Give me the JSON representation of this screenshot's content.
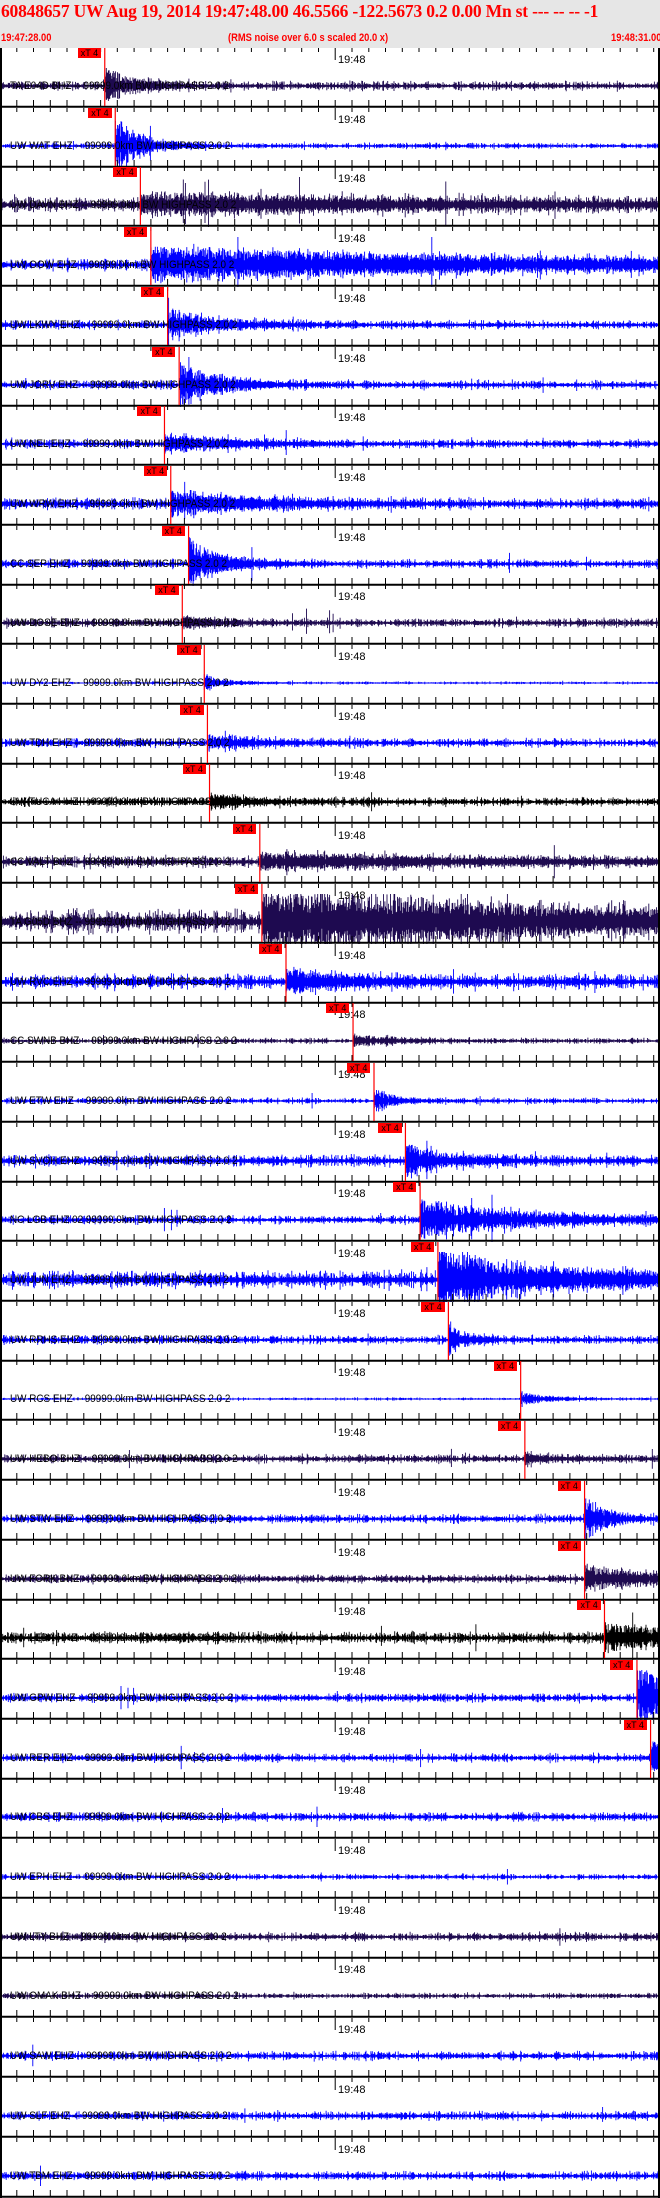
{
  "header": {
    "title": "60848657 UW Aug 19, 2014 19:47:48.00   46.5566 -122.5673  0.2 0.00 Mn st --- -- --  -1",
    "start_time": "19:47:28.00",
    "scaling_note": "(RMS noise over 6.0 s scaled 20.0 x)",
    "end_time": "19:48:31.00"
  },
  "axis": {
    "window_seconds": 63,
    "minute_mark_label": "19:48",
    "minute_mark_offset_s": 32
  },
  "colors": {
    "blue": "#0000ff",
    "purple": "#1e0a50",
    "black": "#000000",
    "pick": "#ff0000"
  },
  "pick_label": "xT 4",
  "stations": [
    {
      "label": "TA E04D BHZ -- 99999.0km BW  HIGHPASS  2.0  2",
      "color": "purple",
      "pick_s": 10.0,
      "noise": 3,
      "amp": 14,
      "decay": 3
    },
    {
      "label": "UW WAT EHZ -- 99999.0km BW  HIGHPASS  2.0  2",
      "color": "blue",
      "pick_s": 11.0,
      "noise": 2,
      "amp": 26,
      "decay": 2.5
    },
    {
      "label": "UW DAVN BHZ -- 99999.0km BW  HIGHPASS  2.0  2",
      "color": "purple",
      "pick_s": 13.4,
      "noise": 5,
      "amp": 8,
      "decay": 30
    },
    {
      "label": "UW OOW EHZ -- 99999.0km BW  HIGHPASS  2.0  2",
      "color": "blue",
      "pick_s": 14.4,
      "noise": 4,
      "amp": 14,
      "decay": 40
    },
    {
      "label": "UW LKWY EHZ -- 99999.0km BW  HIGHPASS  2.0  2",
      "color": "blue",
      "pick_s": 16.0,
      "noise": 3,
      "amp": 12,
      "decay": 5
    },
    {
      "label": "UW JORV EHZ -- 99999.0km BW  HIGHPASS  2.0  2",
      "color": "blue",
      "pick_s": 17.1,
      "noise": 3,
      "amp": 18,
      "decay": 4
    },
    {
      "label": "UW NEL EHZ -- 99999.0km BW  HIGHPASS  2.0  2",
      "color": "blue",
      "pick_s": 15.7,
      "noise": 3,
      "amp": 8,
      "decay": 6
    },
    {
      "label": "UW WRW EHZ -- 99999.0km BW  HIGHPASS  2.0  2",
      "color": "blue",
      "pick_s": 16.3,
      "noise": 4,
      "amp": 10,
      "decay": 8
    },
    {
      "label": "CC SEP EHZ -- 99999.0km BW  HIGHPASS  2.0  2",
      "color": "blue",
      "pick_s": 18.0,
      "noise": 3,
      "amp": 22,
      "decay": 3
    },
    {
      "label": "UW DOSE BHZ -- 99999.0km BW  HIGHPASS  2.0  2",
      "color": "purple",
      "pick_s": 17.4,
      "noise": 3,
      "amp": 6,
      "decay": 3
    },
    {
      "label": "UW DY2 EHZ -- 99999.0km BW  HIGHPASS  2.0  2",
      "color": "blue",
      "pick_s": 19.5,
      "noise": 1,
      "amp": 8,
      "decay": 2
    },
    {
      "label": "UW TDH EHZ -- 99999.0km BW  HIGHPASS  2.0  2",
      "color": "blue",
      "pick_s": 19.8,
      "noise": 3,
      "amp": 6,
      "decay": 5
    },
    {
      "label": "UW TUCA HHZ -- 99999.0km BW  HIGHPASS  2.0  2",
      "color": "black",
      "pick_s": 20.0,
      "noise": 3,
      "amp": 6,
      "decay": 4
    },
    {
      "label": "CC VALT BHZ -- 99999.0km BW  HIGHPASS  2.0  2",
      "color": "purple",
      "pick_s": 24.8,
      "noise": 4,
      "amp": 6,
      "decay": 20
    },
    {
      "label": "TA G05D BHZ -- 99999.0km BW  HIGHPASS  2.0  2",
      "color": "purple",
      "pick_s": 25.0,
      "noise": 8,
      "amp": 24,
      "decay": 30
    },
    {
      "label": "UW RVC EHZ -- 99999.0km BW  HIGHPASS  2.0  2",
      "color": "blue",
      "pick_s": 27.3,
      "noise": 5,
      "amp": 10,
      "decay": 6
    },
    {
      "label": "CC SWNB BHZ -- 99999.0km BW  HIGHPASS  2.0  2",
      "color": "purple",
      "pick_s": 33.7,
      "noise": 2,
      "amp": 5,
      "decay": 4
    },
    {
      "label": "UW ETW EHZ -- 99999.0km BW  HIGHPASS  2.0  2",
      "color": "blue",
      "pick_s": 35.7,
      "noise": 2,
      "amp": 10,
      "decay": 2
    },
    {
      "label": "UW SVOH EHZ -- 99999.0km BW  HIGHPASS  2.0  2",
      "color": "blue",
      "pick_s": 38.7,
      "noise": 4,
      "amp": 14,
      "decay": 4
    },
    {
      "label": "NC LGB EHZ 02 99999.0km BW  HIGHPASS  2.0  2",
      "color": "blue",
      "pick_s": 40.1,
      "noise": 3,
      "amp": 16,
      "decay": 10
    },
    {
      "label": "UW JUN EHZ -- 99999.0km BW  HIGHPASS  2.0  2",
      "color": "blue",
      "pick_s": 41.8,
      "noise": 6,
      "amp": 24,
      "decay": 10
    },
    {
      "label": "UW RRHS EHZ -- 99999.0km BW  HIGHPASS  2.0  2",
      "color": "blue",
      "pick_s": 42.8,
      "noise": 3,
      "amp": 10,
      "decay": 2
    },
    {
      "label": "UW RCS EHZ -- 99999.0km BW  HIGHPASS  2.0  2",
      "color": "blue",
      "pick_s": 49.7,
      "noise": 1,
      "amp": 6,
      "decay": 3
    },
    {
      "label": "UW HEBO BHZ -- 99999.0km BW  HIGHPASS  2.0  2",
      "color": "purple",
      "pick_s": 50.1,
      "noise": 3,
      "amp": 4,
      "decay": 3
    },
    {
      "label": "UW STW EHZ -- 99999.0km BW  HIGHPASS  2.0  2",
      "color": "blue",
      "pick_s": 55.8,
      "noise": 3,
      "amp": 20,
      "decay": 2
    },
    {
      "label": "UW FORK BHZ -- 99999.0km BW  HIGHPASS  2.0  2",
      "color": "purple",
      "pick_s": 55.8,
      "noise": 3,
      "amp": 10,
      "decay": 8
    },
    {
      "label": "UW LEBA HHZ -- 99999.0km BW  HIGHPASS  2.0  2",
      "color": "black",
      "pick_s": 57.7,
      "noise": 4,
      "amp": 12,
      "decay": 8
    },
    {
      "label": "UW GPW EHZ -- 99999.0km BW  HIGHPASS  2.0  2",
      "color": "blue",
      "pick_s": 60.8,
      "noise": 3,
      "amp": 24,
      "decay": 5
    },
    {
      "label": "UW RER EHZ -- 99999.0km BW  HIGHPASS  2.0  2",
      "color": "blue",
      "pick_s": 62.1,
      "noise": 3,
      "amp": 14,
      "decay": 5
    },
    {
      "label": "UW CBS EHZ -- 99999.0km BW  HIGHPASS  2.0  2",
      "color": "blue",
      "pick_s": null,
      "noise": 3,
      "amp": 0,
      "decay": 1
    },
    {
      "label": "UW EPH EHZ -- 99999.0km BW  HIGHPASS  2.0  2",
      "color": "blue",
      "pick_s": null,
      "noise": 2,
      "amp": 0,
      "decay": 1
    },
    {
      "label": "UW LTY BHZ -- 99999.0km BW  HIGHPASS  2.0  2",
      "color": "purple",
      "pick_s": null,
      "noise": 3,
      "amp": 0,
      "decay": 1
    },
    {
      "label": "UW OMAK BHZ -- 99999.0km BW  HIGHPASS  2.0  2",
      "color": "purple",
      "pick_s": null,
      "noise": 2,
      "amp": 0,
      "decay": 1
    },
    {
      "label": "UW SAW EHZ -- 99999.0km BW  HIGHPASS  2.0  2",
      "color": "blue",
      "pick_s": null,
      "noise": 3,
      "amp": 0,
      "decay": 1
    },
    {
      "label": "UW SLF EHZ -- 99999.0km BW  HIGHPASS  2.0  2",
      "color": "blue",
      "pick_s": null,
      "noise": 3,
      "amp": 0,
      "decay": 1
    },
    {
      "label": "UW TBM EHZ -- 99999.0km BW  HIGHPASS  2.0  2",
      "color": "blue",
      "pick_s": null,
      "noise": 3,
      "amp": 0,
      "decay": 1
    }
  ]
}
